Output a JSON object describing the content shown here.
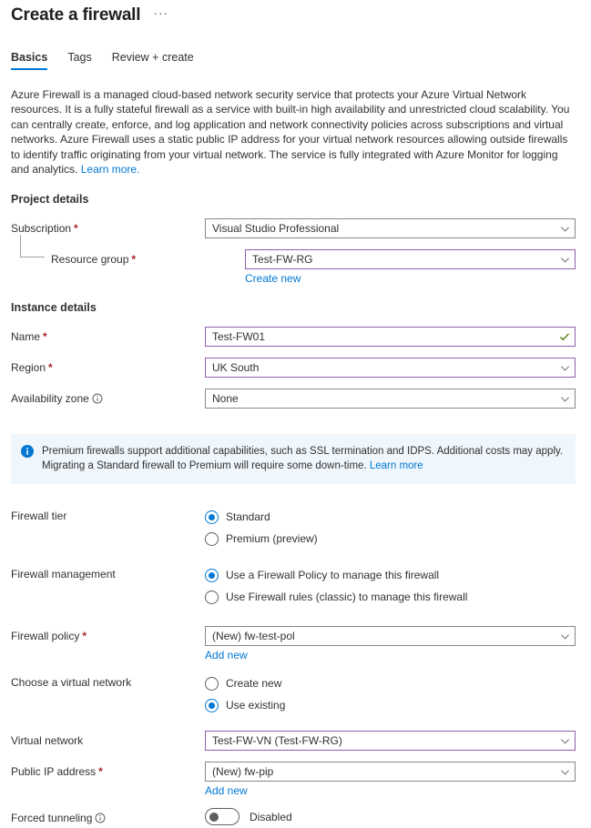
{
  "header": {
    "title": "Create a firewall",
    "more_options": "···"
  },
  "tabs": [
    {
      "label": "Basics",
      "active": true
    },
    {
      "label": "Tags",
      "active": false
    },
    {
      "label": "Review + create",
      "active": false
    }
  ],
  "description": {
    "text": "Azure Firewall is a managed cloud-based network security service that protects your Azure Virtual Network resources. It is a fully stateful firewall as a service with built-in high availability and unrestricted cloud scalability. You can centrally create, enforce, and log application and network connectivity policies across subscriptions and virtual networks. Azure Firewall uses a static public IP address for your virtual network resources allowing outside firewalls to identify traffic originating from your virtual network. The service is fully integrated with Azure Monitor for logging and analytics.",
    "link": "Learn more."
  },
  "project_details": {
    "section_title": "Project details",
    "subscription": {
      "label": "Subscription",
      "required": "*",
      "value": "Visual Studio Professional"
    },
    "resource_group": {
      "label": "Resource group",
      "required": "*",
      "value": "Test-FW-RG",
      "create_new": "Create new"
    }
  },
  "instance_details": {
    "section_title": "Instance details",
    "name": {
      "label": "Name",
      "required": "*",
      "value": "Test-FW01"
    },
    "region": {
      "label": "Region",
      "required": "*",
      "value": "UK South"
    },
    "availability_zone": {
      "label": "Availability zone",
      "value": "None"
    }
  },
  "info_banner": {
    "text": "Premium firewalls support additional capabilities, such as SSL termination and IDPS. Additional costs may apply. Migrating a Standard firewall to Premium will require some down-time.",
    "link": "Learn more"
  },
  "firewall_tier": {
    "label": "Firewall tier",
    "options": [
      {
        "label": "Standard",
        "selected": true
      },
      {
        "label": "Premium (preview)",
        "selected": false
      }
    ]
  },
  "firewall_management": {
    "label": "Firewall management",
    "options": [
      {
        "label": "Use a Firewall Policy to manage this firewall",
        "selected": true
      },
      {
        "label": "Use Firewall rules (classic) to manage this firewall",
        "selected": false
      }
    ]
  },
  "firewall_policy": {
    "label": "Firewall policy",
    "required": "*",
    "value": "(New) fw-test-pol",
    "add_new": "Add new"
  },
  "choose_virtual_network": {
    "label": "Choose a virtual network",
    "options": [
      {
        "label": "Create new",
        "selected": false
      },
      {
        "label": "Use existing",
        "selected": true
      }
    ]
  },
  "virtual_network": {
    "label": "Virtual network",
    "value": "Test-FW-VN (Test-FW-RG)"
  },
  "public_ip_address": {
    "label": "Public IP address",
    "required": "*",
    "value": "(New) fw-pip",
    "add_new": "Add new"
  },
  "forced_tunneling": {
    "label": "Forced tunneling",
    "state": "Disabled",
    "enabled": false
  },
  "colors": {
    "accent": "#0078d4",
    "required_red": "#a4262c",
    "focus_purple": "#8f5eaa",
    "success_green": "#498205",
    "banner_bg": "#eff6fc"
  }
}
